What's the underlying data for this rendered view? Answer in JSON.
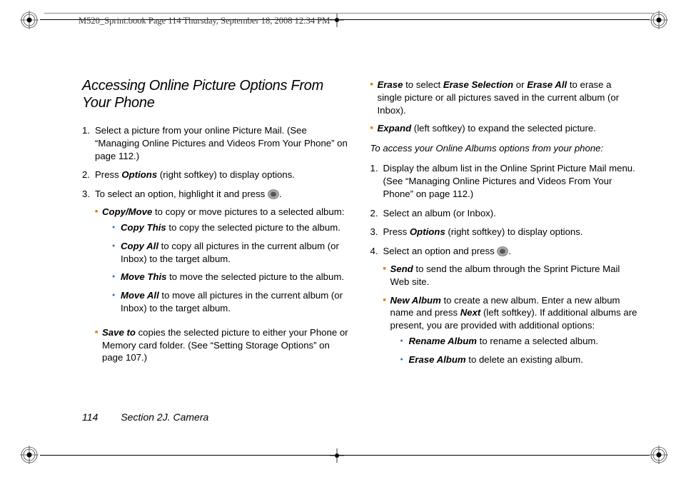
{
  "crop_header": "M520_Sprint.book  Page 114  Thursday, September 18, 2008  12:34 PM",
  "title": "Accessing Online Picture Options From Your Phone",
  "left": {
    "step1": "Select a picture from your online Picture Mail. (See “Managing Online Pictures and Videos From Your Phone” on page 112.)",
    "step2_pre": "Press ",
    "step2_b": "Options",
    "step2_post": " (right softkey) to display options.",
    "step3_pre": "To select an option, highlight it and press ",
    "step3_post": ".",
    "cm_b": "Copy/Move",
    "cm_post": " to copy or move pictures to a selected album:",
    "ct_b": "Copy This",
    "ct_post": " to copy the selected picture to the album.",
    "ca_b": "Copy All",
    "ca_post": " to copy all pictures in the current album (or Inbox) to the target album.",
    "mt_b": "Move This",
    "mt_post": " to move the selected picture to the album.",
    "ma_b": "Move All",
    "ma_post": " to move all pictures in the current album (or Inbox) to the target album.",
    "st_b": "Save to",
    "st_post": " copies the selected picture to either your Phone or Memory card folder. (See “Setting Storage Options” on page 107.)"
  },
  "right": {
    "er_b": "Erase",
    "er_mid1": " to select ",
    "er_b2": "Erase Selection",
    "er_mid2": " or ",
    "er_b3": "Erase All",
    "er_post": " to erase a single picture or all pictures saved in the current album (or Inbox).",
    "ex_b": "Expand",
    "ex_post": " (left softkey) to expand the selected picture.",
    "subtitle": "To access your Online Albums options from your phone:",
    "s1": "Display the album list in the Online Sprint Picture Mail menu. (See “Managing Online Pictures and Videos From Your Phone” on page 112.)",
    "s2": "Select an album (or Inbox).",
    "s3_pre": "Press ",
    "s3_b": "Options",
    "s3_post": " (right softkey) to display options.",
    "s4_pre": "Select an option and press ",
    "s4_post": ".",
    "send_b": "Send",
    "send_post": " to send the album through the Sprint Picture Mail Web site.",
    "na_b": "New Album",
    "na_mid": " to create a new album. Enter a new album name and press ",
    "na_b2": "Next",
    "na_post": " (left softkey). If additional albums are present, you are provided with additional options:",
    "ra_b": "Rename Album",
    "ra_post": " to rename a selected album.",
    "ea_b": "Erase Album",
    "ea_post": " to delete an existing album."
  },
  "footer": {
    "page": "114",
    "section": "Section 2J. Camera"
  },
  "nums": {
    "n1": "1.",
    "n2": "2.",
    "n3": "3.",
    "n4": "4."
  }
}
